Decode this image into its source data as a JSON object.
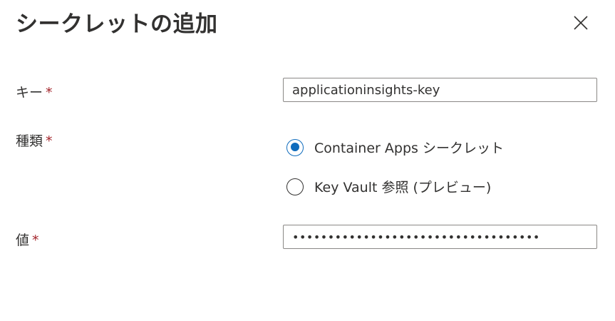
{
  "dialog": {
    "title": "シークレットの追加",
    "close_label": "Close"
  },
  "form": {
    "key": {
      "label": "キー",
      "required_mark": "*",
      "value": "applicationinsights-key"
    },
    "type": {
      "label": "種類",
      "required_mark": "*",
      "options": [
        {
          "label": "Container Apps シークレット",
          "selected": true
        },
        {
          "label": "Key Vault 参照 (プレビュー)",
          "selected": false
        }
      ]
    },
    "value": {
      "label": "値",
      "required_mark": "*",
      "masked_value": "•••••••••••••••••••••••••••••••••••"
    }
  },
  "colors": {
    "accent": "#0f6cbd",
    "required": "#a4262c",
    "text": "#323130",
    "border": "#8a8886"
  },
  "icons": {
    "close": "close-icon"
  }
}
